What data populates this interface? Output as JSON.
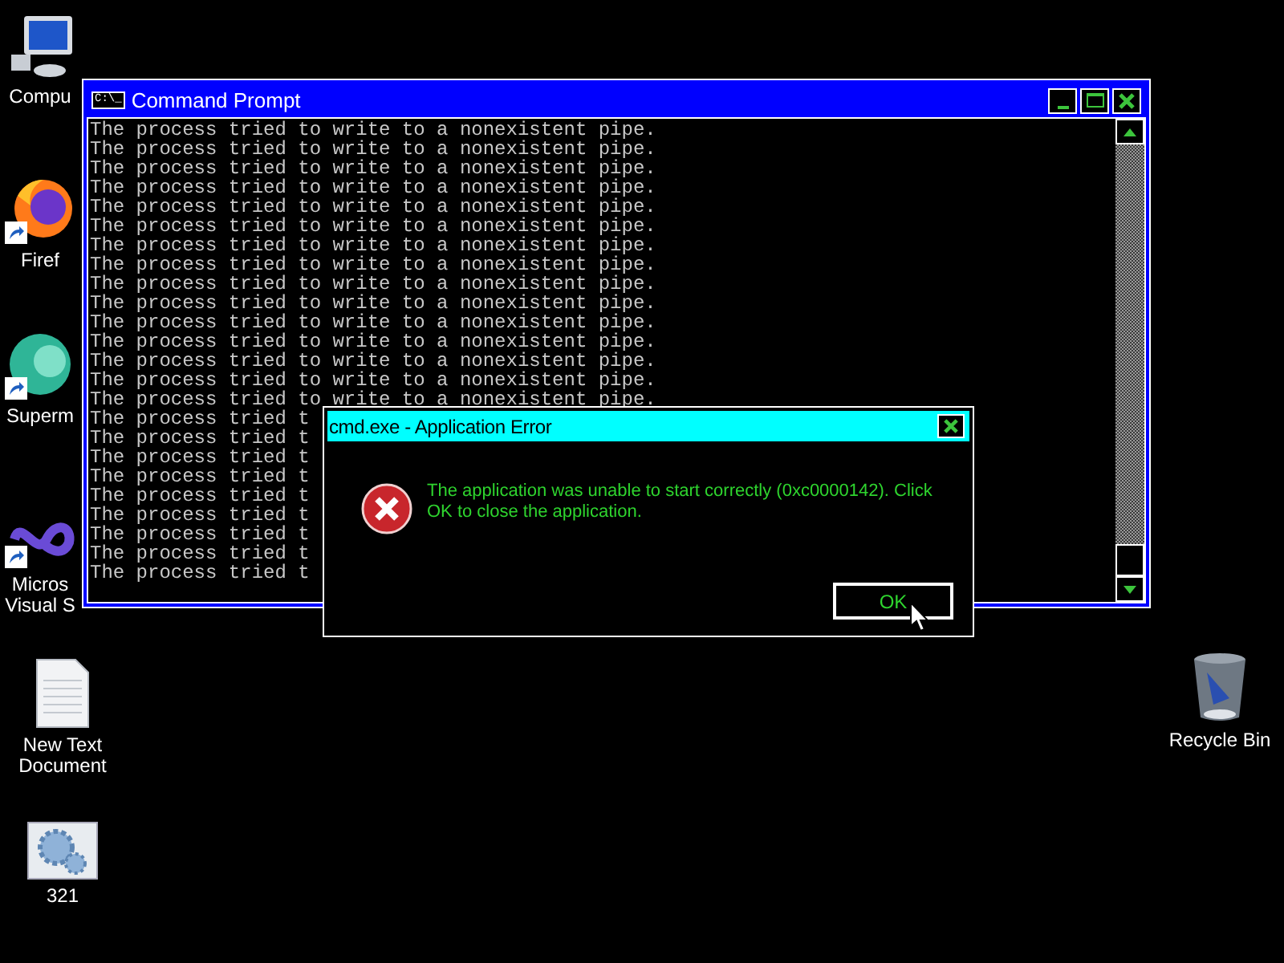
{
  "desktop_icons": [
    {
      "kind": "computer",
      "lines": [
        "Compu"
      ],
      "shortcut": false
    },
    {
      "kind": "firefox",
      "lines": [
        "Firef"
      ],
      "shortcut": true
    },
    {
      "kind": "orb",
      "lines": [
        "Superm"
      ],
      "shortcut": true
    },
    {
      "kind": "infinity",
      "lines": [
        "Micros",
        "Visual S"
      ],
      "shortcut": true
    },
    {
      "kind": "document",
      "lines": [
        "New Text",
        "Document"
      ],
      "shortcut": false
    },
    {
      "kind": "gears",
      "lines": [
        "321"
      ],
      "shortcut": false
    },
    {
      "kind": "recycle",
      "lines": [
        "Recycle Bin"
      ],
      "shortcut": false
    }
  ],
  "console_window": {
    "title": "Command Prompt",
    "title_icon": "C:\\_",
    "lines": [
      "The process tried to write to a nonexistent pipe.",
      "The process tried to write to a nonexistent pipe.",
      "The process tried to write to a nonexistent pipe.",
      "The process tried to write to a nonexistent pipe.",
      "The process tried to write to a nonexistent pipe.",
      "The process tried to write to a nonexistent pipe.",
      "The process tried to write to a nonexistent pipe.",
      "The process tried to write to a nonexistent pipe.",
      "The process tried to write to a nonexistent pipe.",
      "The process tried to write to a nonexistent pipe.",
      "The process tried to write to a nonexistent pipe.",
      "The process tried to write to a nonexistent pipe.",
      "The process tried to write to a nonexistent pipe.",
      "The process tried to write to a nonexistent pipe.",
      "The process tried to write to a nonexistent pipe.",
      "The process tried t",
      "The process tried t",
      "The process tried t",
      "The process tried t",
      "The process tried t",
      "The process tried t",
      "The process tried t",
      "The process tried t",
      "The process tried t"
    ]
  },
  "error_dialog": {
    "title": "cmd.exe - Application Error",
    "message": "The application was unable to start correctly (0xc0000142). Click OK to close the application.",
    "button": "OK"
  }
}
